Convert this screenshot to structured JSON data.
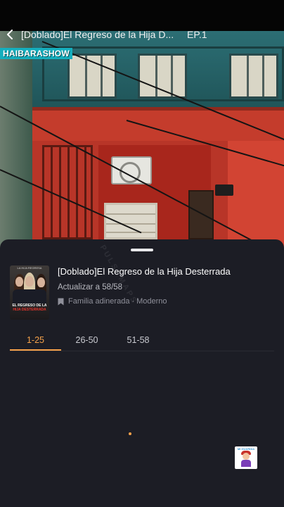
{
  "header": {
    "title": "[Doblado]El Regreso de la Hija D...",
    "episode": "EP.1"
  },
  "video": {
    "channel_tag": "HAIBARASHOW"
  },
  "sheet": {
    "watermark": "PULSEMAPS",
    "series": {
      "title": "[Doblado]El Regreso de la Hija Desterrada",
      "update_status": "Actualizar a 58/58",
      "tags": [
        "Familia adinerada",
        "Moderno"
      ],
      "tag_separator": "·",
      "tag_icon": "bookmark-icon"
    },
    "poster": {
      "top_text": "LA HIJA REGRESA",
      "title_line1": "EL REGRESO DE LA",
      "title_line2": "HIJA DESTERRADA"
    },
    "episode_tabs": [
      {
        "label": "1-25",
        "active": true
      },
      {
        "label": "26-50",
        "active": false
      },
      {
        "label": "51-58",
        "active": false
      }
    ],
    "sticker_text": "MI GUARDIA"
  },
  "colors": {
    "accent": "#f5a14a",
    "sheet_bg": "#1c1d25",
    "channel_tag_bg": "#15aebd"
  }
}
